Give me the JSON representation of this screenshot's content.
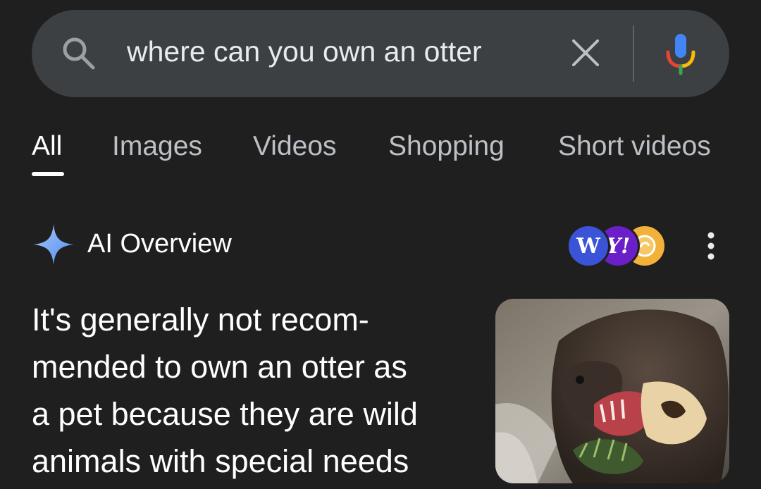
{
  "search": {
    "query": "where can you own an otter"
  },
  "tabs": [
    {
      "label": "All",
      "active": true
    },
    {
      "label": "Images",
      "active": false
    },
    {
      "label": "Videos",
      "active": false
    },
    {
      "label": "Shopping",
      "active": false
    },
    {
      "label": "Short videos",
      "active": false
    }
  ],
  "ai_overview": {
    "title": "AI Overview",
    "text_lines": [
      "It's generally not recom-",
      "mended to own an otter as",
      "a pet because they are wild",
      "animals with special needs"
    ],
    "sources": [
      {
        "icon": "wikipedia-source-icon",
        "letter": "W",
        "color": "#3b53d6"
      },
      {
        "icon": "yahoo-source-icon",
        "letter": "Y!",
        "color": "#6a1fc9"
      },
      {
        "icon": "source-logo-icon",
        "letter": "",
        "color": "#f2b23a"
      }
    ],
    "image": "otter-photo"
  },
  "colors": {
    "background": "#1f1f1f",
    "search_bar": "#3c4043",
    "accent_sparkle": "#8ab4f8"
  }
}
